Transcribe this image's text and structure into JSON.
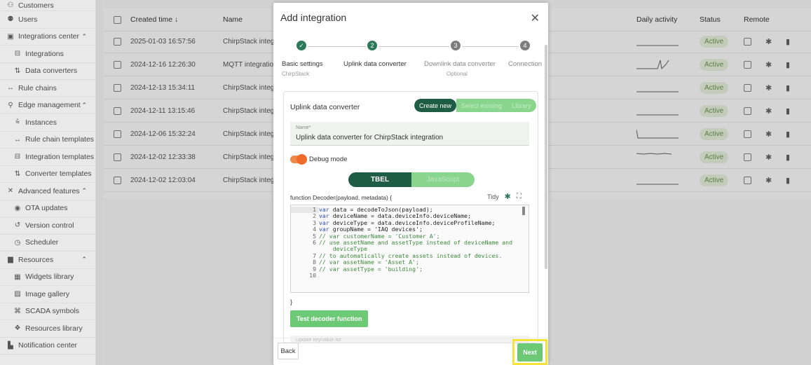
{
  "sidebar": {
    "items": [
      {
        "label": "Customers",
        "icon": "customers-icon",
        "glyph": "⚇",
        "sub": false,
        "chevron": false
      },
      {
        "label": "Users",
        "icon": "users-icon",
        "glyph": "⚉",
        "sub": false,
        "chevron": false
      },
      {
        "label": "Integrations center",
        "icon": "integrations-icon",
        "glyph": "▣",
        "sub": false,
        "chevron": true
      },
      {
        "label": "Integrations",
        "icon": "integration-icon",
        "glyph": "⊟",
        "sub": true,
        "chevron": false
      },
      {
        "label": "Data converters",
        "icon": "converter-icon",
        "glyph": "⇅",
        "sub": true,
        "chevron": false
      },
      {
        "label": "Rule chains",
        "icon": "rule-chain-icon",
        "glyph": "↔",
        "sub": false,
        "chevron": false
      },
      {
        "label": "Edge management",
        "icon": "edge-icon",
        "glyph": "⚲",
        "sub": false,
        "chevron": true
      },
      {
        "label": "Instances",
        "icon": "instances-icon",
        "glyph": "⩯",
        "sub": true,
        "chevron": false
      },
      {
        "label": "Rule chain templates",
        "icon": "rule-template-icon",
        "glyph": "↔",
        "sub": true,
        "chevron": false
      },
      {
        "label": "Integration templates",
        "icon": "integration-template-icon",
        "glyph": "⊟",
        "sub": true,
        "chevron": false
      },
      {
        "label": "Converter templates",
        "icon": "converter-template-icon",
        "glyph": "⇅",
        "sub": true,
        "chevron": false
      },
      {
        "label": "Advanced features",
        "icon": "advanced-icon",
        "glyph": "✕",
        "sub": false,
        "chevron": true
      },
      {
        "label": "OTA updates",
        "icon": "ota-icon",
        "glyph": "◉",
        "sub": true,
        "chevron": false
      },
      {
        "label": "Version control",
        "icon": "version-icon",
        "glyph": "↺",
        "sub": true,
        "chevron": false
      },
      {
        "label": "Scheduler",
        "icon": "scheduler-icon",
        "glyph": "◷",
        "sub": true,
        "chevron": false
      },
      {
        "label": "Resources",
        "icon": "resources-icon",
        "glyph": "▆",
        "sub": false,
        "chevron": true
      },
      {
        "label": "Widgets library",
        "icon": "widgets-icon",
        "glyph": "▦",
        "sub": true,
        "chevron": false
      },
      {
        "label": "Image gallery",
        "icon": "image-icon",
        "glyph": "▨",
        "sub": true,
        "chevron": false
      },
      {
        "label": "SCADA symbols",
        "icon": "scada-icon",
        "glyph": "⌘",
        "sub": true,
        "chevron": false
      },
      {
        "label": "Resources library",
        "icon": "library-icon",
        "glyph": "❖",
        "sub": true,
        "chevron": false
      },
      {
        "label": "Notification center",
        "icon": "notification-icon",
        "glyph": "▙",
        "sub": false,
        "chevron": false
      }
    ],
    "chevron_glyph": "⌃"
  },
  "table": {
    "headers": {
      "created": "Created time ↓",
      "name": "Name",
      "daily": "Daily activity",
      "status": "Status",
      "remote": "Remote"
    },
    "rows": [
      {
        "time": "2025-01-03 16:57:56",
        "name": "ChirpStack integration-",
        "status": "Active",
        "activity": "flat"
      },
      {
        "time": "2024-12-16 12:26:30",
        "name": "MQTT integration-GPS",
        "status": "Active",
        "activity": "spike"
      },
      {
        "time": "2024-12-13 15:34:11",
        "name": "ChirpStack integration-",
        "status": "Active",
        "activity": "flat"
      },
      {
        "time": "2024-12-11 13:15:46",
        "name": "ChirpStack integration-",
        "status": "Active",
        "activity": "flat"
      },
      {
        "time": "2024-12-06 15:32:24",
        "name": "ChirpStack integration-",
        "status": "Active",
        "activity": "drop"
      },
      {
        "time": "2024-12-02 12:33:38",
        "name": "ChirpStack integration-",
        "status": "Active",
        "activity": "wavy"
      },
      {
        "time": "2024-12-02 12:03:04",
        "name": "ChirpStack integration",
        "status": "Active",
        "activity": "flat"
      }
    ],
    "action_glyphs": {
      "bug": "✱",
      "delete": "▮"
    }
  },
  "dialog": {
    "title": "Add integration",
    "close_glyph": "✕",
    "steps": [
      {
        "num": "✓",
        "label": "Basic settings",
        "sub": "ChirpStack",
        "state": "done"
      },
      {
        "num": "2",
        "label": "Uplink data converter",
        "sub": "",
        "state": "active"
      },
      {
        "num": "3",
        "label": "Downlink data converter",
        "sub": "Optional",
        "state": "todo"
      },
      {
        "num": "4",
        "label": "Connection",
        "sub": "",
        "state": "todo"
      }
    ],
    "card": {
      "title": "Uplink data converter",
      "seg_create": "Create new",
      "seg_select": "Select existing",
      "seg_library": "Library",
      "name_label": "Name*",
      "name_value": "Uplink data converter for ChirpStack integration",
      "debug_label": "Debug mode",
      "lang_tbel": "TBEL",
      "lang_js": "JavaScript",
      "fn_signature": "function Decoder(payload, metadata) {",
      "tidy_label": "Tidy",
      "close_brace": "}",
      "test_button": "Test decoder function",
      "update_hint": "Update key/value list"
    },
    "code_lines": [
      {
        "n": "1",
        "html": "<span class='kw'>var</span> data = decodeToJson(payload);"
      },
      {
        "n": "2",
        "html": "<span class='kw'>var</span> deviceName = data.deviceInfo.deviceName;"
      },
      {
        "n": "3",
        "html": "<span class='kw'>var</span> deviceType = data.deviceInfo.deviceProfileName;"
      },
      {
        "n": "4",
        "html": "<span class='kw'>var</span> groupName = 'IAQ devices';"
      },
      {
        "n": "5",
        "html": "<span class='cm'>// var customerName = 'Customer A';</span>"
      },
      {
        "n": "6",
        "html": "<span class='cm'>// use assetName and assetType instead of deviceName and</span>"
      },
      {
        "n": "",
        "html": "<span class='cm'>    deviceType</span>"
      },
      {
        "n": "7",
        "html": "<span class='cm'>// to automatically create assets instead of devices.</span>"
      },
      {
        "n": "8",
        "html": "<span class='cm'>// var assetName = 'Asset A';</span>"
      },
      {
        "n": "9",
        "html": "<span class='cm'>// var assetType = 'building';</span>"
      },
      {
        "n": "10",
        "html": ""
      }
    ],
    "back_button": "Back",
    "next_button": "Next"
  }
}
